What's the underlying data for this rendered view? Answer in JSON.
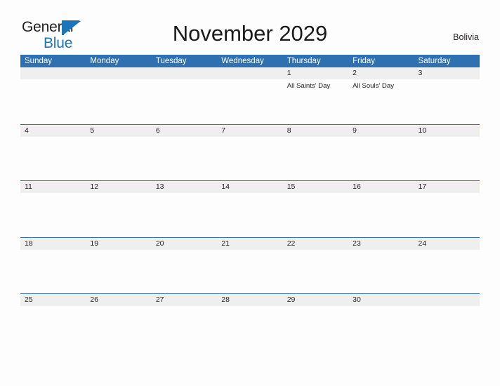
{
  "brand": {
    "word1": "General",
    "word2": "Blue",
    "flag_icon": "blue-triangle-flag-icon",
    "color_text": "#231f20",
    "color_blue": "#1b75bb"
  },
  "header": {
    "title": "November 2029",
    "region": "Bolivia"
  },
  "theme": {
    "header_blue": "#2e70b0",
    "day_band_gray": "#efefef",
    "page_background": "#fdfdfd",
    "text": "#231f20"
  },
  "calendar": {
    "weekdays": [
      "Sunday",
      "Monday",
      "Tuesday",
      "Wednesday",
      "Thursday",
      "Friday",
      "Saturday"
    ],
    "weeks": [
      {
        "days": [
          {
            "num": "",
            "events": []
          },
          {
            "num": "",
            "events": []
          },
          {
            "num": "",
            "events": []
          },
          {
            "num": "",
            "events": []
          },
          {
            "num": "1",
            "events": [
              "All Saints' Day"
            ]
          },
          {
            "num": "2",
            "events": [
              "All Souls' Day"
            ]
          },
          {
            "num": "3",
            "events": []
          }
        ]
      },
      {
        "days": [
          {
            "num": "4",
            "events": []
          },
          {
            "num": "5",
            "events": []
          },
          {
            "num": "6",
            "events": []
          },
          {
            "num": "7",
            "events": []
          },
          {
            "num": "8",
            "events": []
          },
          {
            "num": "9",
            "events": []
          },
          {
            "num": "10",
            "events": []
          }
        ]
      },
      {
        "days": [
          {
            "num": "11",
            "events": []
          },
          {
            "num": "12",
            "events": []
          },
          {
            "num": "13",
            "events": []
          },
          {
            "num": "14",
            "events": []
          },
          {
            "num": "15",
            "events": []
          },
          {
            "num": "16",
            "events": []
          },
          {
            "num": "17",
            "events": []
          }
        ]
      },
      {
        "days": [
          {
            "num": "18",
            "events": []
          },
          {
            "num": "19",
            "events": []
          },
          {
            "num": "20",
            "events": []
          },
          {
            "num": "21",
            "events": []
          },
          {
            "num": "22",
            "events": []
          },
          {
            "num": "23",
            "events": []
          },
          {
            "num": "24",
            "events": []
          }
        ]
      },
      {
        "days": [
          {
            "num": "25",
            "events": []
          },
          {
            "num": "26",
            "events": []
          },
          {
            "num": "27",
            "events": []
          },
          {
            "num": "28",
            "events": []
          },
          {
            "num": "29",
            "events": []
          },
          {
            "num": "30",
            "events": []
          },
          {
            "num": "",
            "events": []
          }
        ]
      }
    ]
  }
}
